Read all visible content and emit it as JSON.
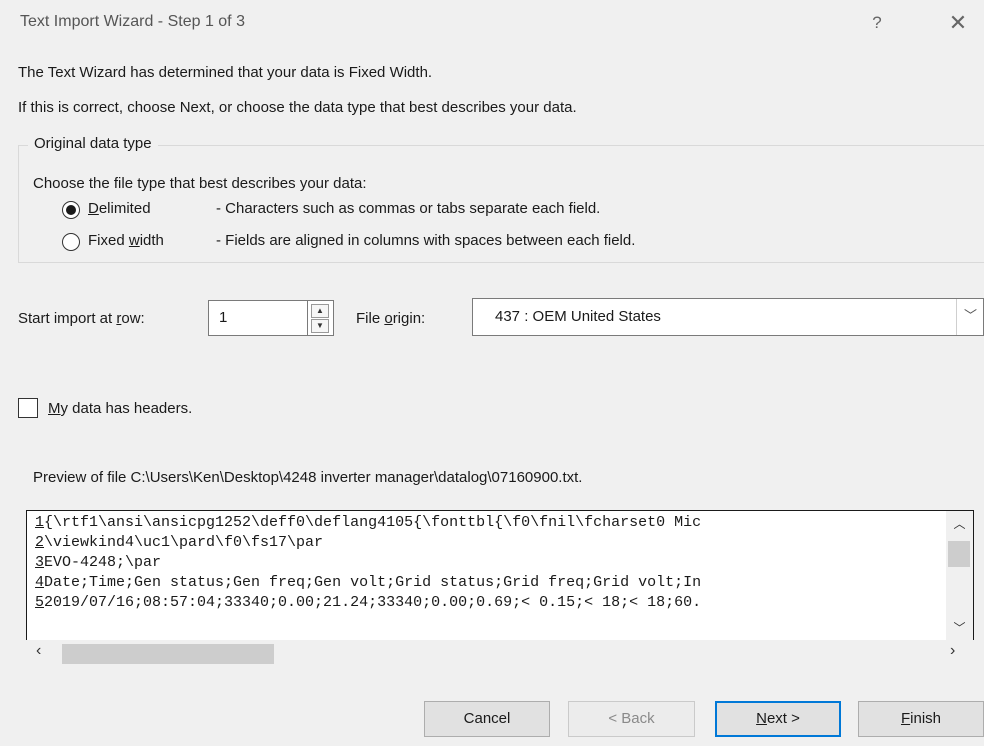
{
  "window": {
    "title": "Text Import Wizard - Step 1 of 3",
    "help_glyph": "?",
    "close_glyph": "✕"
  },
  "intro": {
    "line1": "The Text Wizard has determined that your data is Fixed Width.",
    "line2": "If this is correct, choose Next, or choose the data type that best describes your data."
  },
  "data_type": {
    "group_label": "Original data type",
    "choose_label": "Choose the file type that best describes your data:",
    "options": [
      {
        "label_first": "D",
        "label_rest": "elimited",
        "description": "- Characters such as commas or tabs separate each field.",
        "selected": true
      },
      {
        "label_pre": "Fixed ",
        "label_u": "w",
        "label_post": "idth",
        "description": "- Fields are aligned in columns with spaces between each field.",
        "selected": false
      }
    ]
  },
  "start_row": {
    "label_pre": "Start import at ",
    "label_u": "r",
    "label_post": "ow:",
    "value": "1"
  },
  "file_origin": {
    "label_pre": "File ",
    "label_u": "o",
    "label_post": "rigin:",
    "value": "437 : OEM United States"
  },
  "headers": {
    "label_u": "M",
    "label_post": "y data has headers.",
    "checked": false
  },
  "preview": {
    "label": "Preview of file C:\\Users\\Ken\\Desktop\\4248 inverter manager\\datalog\\07160900.txt.",
    "lines": [
      {
        "num": "1",
        "text": "{\\rtf1\\ansi\\ansicpg1252\\deff0\\deflang4105{\\fonttbl{\\f0\\fnil\\fcharset0 Mic"
      },
      {
        "num": "2",
        "text": "\\viewkind4\\uc1\\pard\\f0\\fs17\\par"
      },
      {
        "num": "3",
        "text": "EVO-4248;\\par"
      },
      {
        "num": "4",
        "text": "Date;Time;Gen status;Gen freq;Gen volt;Grid status;Grid freq;Grid volt;In"
      },
      {
        "num": "5",
        "text": "2019/07/16;08:57:04;33340;0.00;21.24;33340;0.00;0.69;< 0.15;< 18;< 18;60."
      }
    ]
  },
  "buttons": {
    "cancel": "Cancel",
    "back": "< Back",
    "next_u": "N",
    "next_post": "ext >",
    "finish_u": "F",
    "finish_post": "inish"
  }
}
